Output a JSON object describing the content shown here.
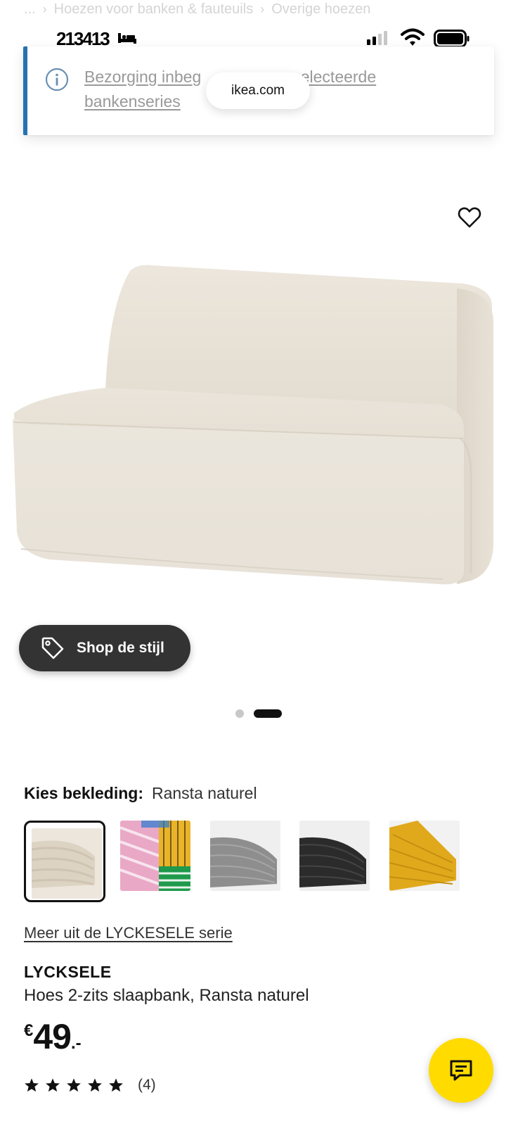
{
  "breadcrumb": {
    "ellipsis": "...",
    "items": [
      "Hoezen voor banken & fauteuils",
      "Overige hoezen"
    ]
  },
  "status_bar": {
    "time": "21:34:13",
    "time_display": "213413",
    "icons": [
      "bed-icon",
      "signal-icon",
      "wifi-icon",
      "battery-icon"
    ]
  },
  "banner": {
    "icon": "info-icon",
    "text_part1": "Bezorging inbeg",
    "text_part2": "selecteerde",
    "text_line2": "bankenseries",
    "accent_color": "#0058a3"
  },
  "url_pill": {
    "domain": "ikea.com"
  },
  "favorite": {
    "icon": "heart-icon"
  },
  "shop_style": {
    "label": "Shop de stijl",
    "icon": "tag-icon"
  },
  "carousel": {
    "count": 2,
    "active_index": 1
  },
  "fabric": {
    "label": "Kies bekleding:",
    "selected": "Ransta naturel",
    "swatches": [
      {
        "name": "Ransta naturel",
        "color": "#e8dfcf",
        "selected": true
      },
      {
        "name": "pink-yellow-green pattern",
        "color": "#e9a8c6",
        "selected": false
      },
      {
        "name": "grey",
        "color": "#8c8c8c",
        "selected": false
      },
      {
        "name": "black",
        "color": "#2b2b2b",
        "selected": false
      },
      {
        "name": "yellow",
        "color": "#e0a91c",
        "selected": false
      }
    ]
  },
  "series_link": "Meer uit de LYCKESELE serie",
  "product": {
    "name": "LYCKSELE",
    "description": "Hoes 2-zits slaapbank, Ransta naturel",
    "price_currency": "€",
    "price_amount": "49",
    "price_suffix": ".-",
    "rating_stars": 5,
    "rating_count": "(4)"
  },
  "chat": {
    "icon": "chat-icon",
    "color": "#ffdb00"
  }
}
